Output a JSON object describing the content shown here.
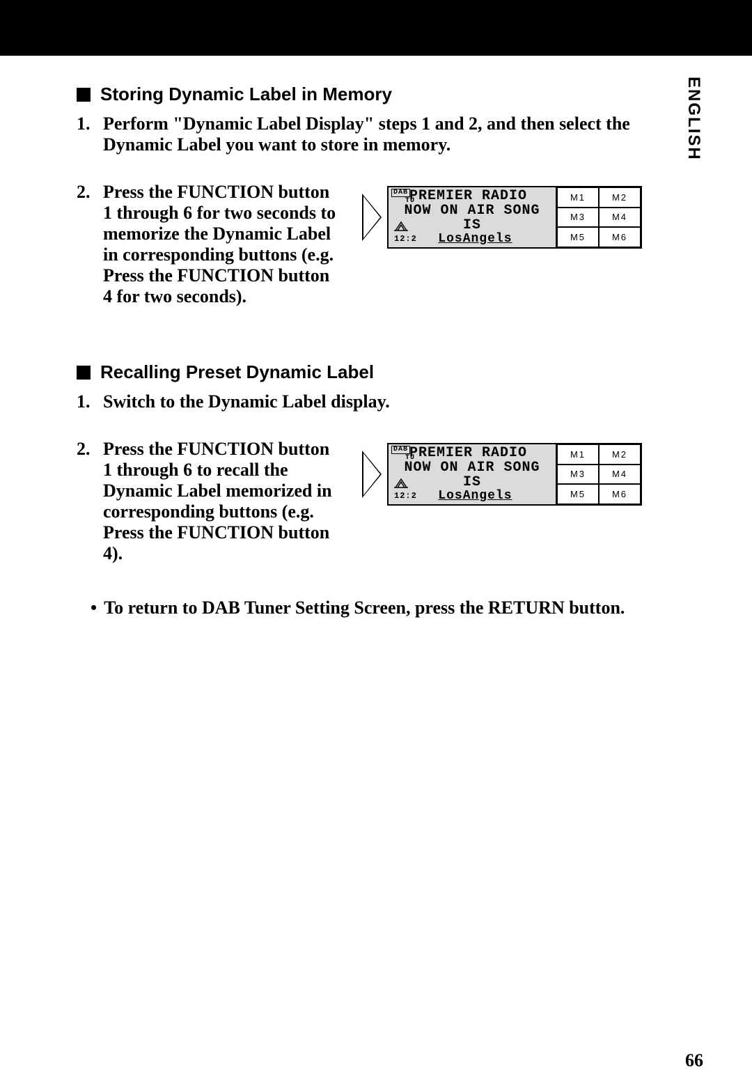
{
  "language_tab": "ENGLISH",
  "section1": {
    "heading": "Storing Dynamic Label in Memory",
    "step1_num": "1.",
    "step1_text": "Perform \"Dynamic Label Display\" steps 1 and 2, and then select the Dynamic Label you want to store in memory.",
    "step2_num": "2.",
    "step2_text": "Press the FUNCTION button 1 through 6 for two seconds to memorize the Dynamic Label in corresponding buttons (e.g. Press the FUNCTION button 4 for two seconds)."
  },
  "section2": {
    "heading": "Recalling Preset Dynamic Label",
    "step1_num": "1.",
    "step1_text": "Switch to the Dynamic Label display.",
    "step2_num": "2.",
    "step2_text": "Press the FUNCTION button 1 through 6 to recall the Dynamic Label memorized in corresponding buttons (e.g. Press the FUNCTION button 4)."
  },
  "display": {
    "badge": "DAB",
    "badge_sub": "TU",
    "line1": "PREMIER RADIO",
    "line2": "NOW ON AIR SONG",
    "line3": "IS",
    "line4": "LosAngels",
    "clock": "12:2",
    "buttons": [
      "M1",
      "M2",
      "M3",
      "M4",
      "M5",
      "M6"
    ]
  },
  "note_bullet": "•",
  "note_text": "To return to DAB Tuner Setting Screen, press the RETURN button.",
  "page_number": "66"
}
